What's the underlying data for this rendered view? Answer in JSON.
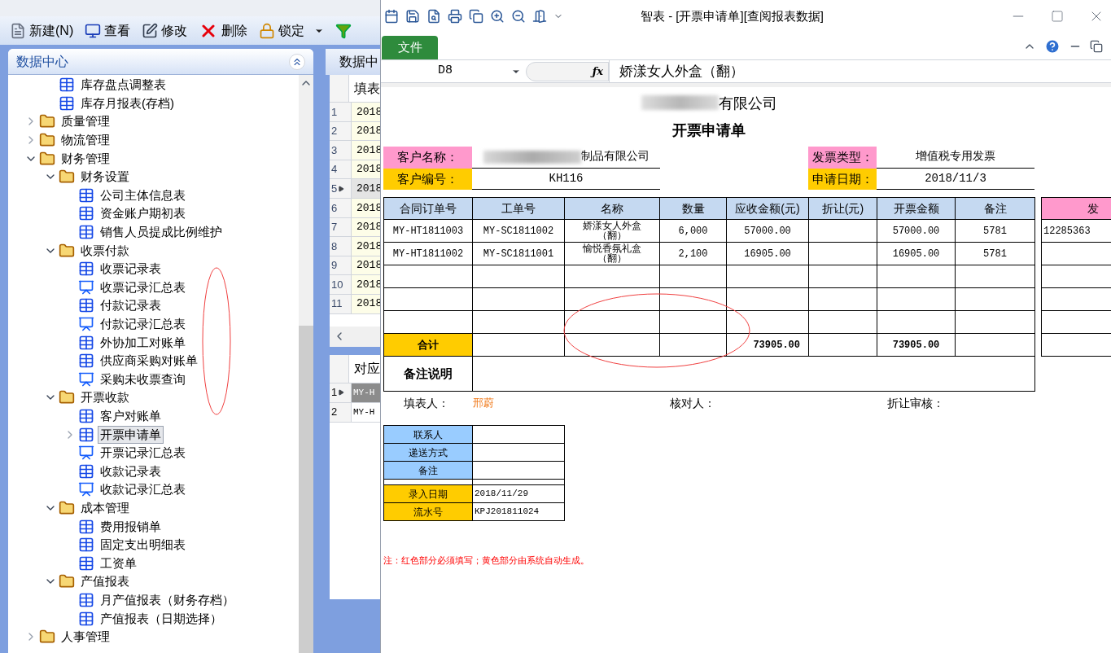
{
  "toolbar": [
    {
      "kind": "new",
      "label": "新建(N)"
    },
    {
      "kind": "view",
      "label": "查看"
    },
    {
      "kind": "edit",
      "label": "修改"
    },
    {
      "kind": "delete",
      "label": "删除"
    },
    {
      "kind": "lock",
      "label": "锁定"
    },
    {
      "kind": "filter"
    }
  ],
  "sidebar": {
    "title": "数据中心",
    "partial_items": [
      {
        "kind": "table",
        "label": "库存盘点调整表",
        "selected": false
      },
      {
        "kind": "table",
        "label": "库存月报表(存档)",
        "selected": false
      }
    ],
    "tree": [
      {
        "kind": "folder",
        "label": "质量管理",
        "expanded": false,
        "selected": false
      },
      {
        "kind": "folder",
        "label": "物流管理",
        "expanded": false,
        "selected": false
      },
      {
        "kind": "folder",
        "label": "财务管理",
        "expanded": true,
        "selected": false,
        "children": [
          {
            "kind": "folder",
            "label": "财务设置",
            "expanded": true,
            "selected": false,
            "children": [
              {
                "kind": "table",
                "label": "公司主体信息表",
                "selected": false
              },
              {
                "kind": "table",
                "label": "资金账户期初表",
                "selected": false
              },
              {
                "kind": "table",
                "label": "销售人员提成比例维护",
                "selected": false
              }
            ]
          },
          {
            "kind": "folder",
            "label": "收票付款",
            "expanded": true,
            "selected": false,
            "children": [
              {
                "kind": "table",
                "label": "收票记录表",
                "selected": false
              },
              {
                "kind": "summary",
                "label": "收票记录汇总表",
                "selected": false
              },
              {
                "kind": "table",
                "label": "付款记录表",
                "selected": false
              },
              {
                "kind": "summary",
                "label": "付款记录汇总表",
                "selected": false
              },
              {
                "kind": "table",
                "label": "外协加工对账单",
                "selected": false
              },
              {
                "kind": "table",
                "label": "供应商采购对账单",
                "selected": false
              },
              {
                "kind": "summary",
                "label": "采购未收票查询",
                "selected": false
              }
            ]
          },
          {
            "kind": "folder",
            "label": "开票收款",
            "expanded": true,
            "selected": false,
            "children": [
              {
                "kind": "table",
                "label": "客户对账单",
                "selected": false
              },
              {
                "kind": "table",
                "label": "开票申请单",
                "selected": true,
                "expanded": false
              },
              {
                "kind": "summary",
                "label": "开票记录汇总表",
                "selected": false
              },
              {
                "kind": "table",
                "label": "收款记录表",
                "selected": false
              },
              {
                "kind": "summary",
                "label": "收款记录汇总表",
                "selected": false
              }
            ]
          },
          {
            "kind": "folder",
            "label": "成本管理",
            "expanded": true,
            "selected": false,
            "children": [
              {
                "kind": "table",
                "label": "费用报销单",
                "selected": false
              },
              {
                "kind": "table",
                "label": "固定支出明细表",
                "selected": false
              },
              {
                "kind": "table",
                "label": "工资单",
                "selected": false
              }
            ]
          },
          {
            "kind": "folder",
            "label": "产值报表",
            "expanded": true,
            "selected": false,
            "children": [
              {
                "kind": "table",
                "label": "月产值报表（财务存档）",
                "selected": false
              },
              {
                "kind": "table",
                "label": "产值报表（日期选择）",
                "selected": false
              }
            ]
          }
        ]
      },
      {
        "kind": "folder",
        "label": "人事管理",
        "expanded": false,
        "selected": false
      }
    ]
  },
  "middle": {
    "tab": "数据中",
    "header": "填表",
    "rows": [
      {
        "num": "1",
        "cell": "2018",
        "selected": false
      },
      {
        "num": "2",
        "cell": "2018",
        "selected": false
      },
      {
        "num": "3",
        "cell": "2018",
        "selected": false
      },
      {
        "num": "4",
        "cell": "2018",
        "selected": false
      },
      {
        "num": "5",
        "cell": "2018",
        "selected": true
      },
      {
        "num": "6",
        "cell": "2018",
        "selected": false
      },
      {
        "num": "7",
        "cell": "2018",
        "selected": false
      },
      {
        "num": "8",
        "cell": "2018",
        "selected": false
      },
      {
        "num": "9",
        "cell": "2018",
        "selected": false
      },
      {
        "num": "10",
        "cell": "2018",
        "selected": false
      },
      {
        "num": "11",
        "cell": "2018",
        "selected": false
      }
    ],
    "lower_header": "对应",
    "lower_rows": [
      {
        "num": "1",
        "cell": "MY-H",
        "selected": true
      },
      {
        "num": "2",
        "cell": "MY-H",
        "selected": false
      }
    ]
  },
  "window": {
    "title": "智表 - [开票申请单][查阅报表数据]",
    "file_tab": "文件",
    "cell_ref": "D8",
    "function_label": "ƒx",
    "formula": "娇漾女人外盒（翻）"
  },
  "sheet": {
    "company": "有限公司",
    "form_title": "开票申请单",
    "left_fields": [
      {
        "label": "客户名称：",
        "value": "制品有限公司",
        "kind": "required",
        "redacted": true
      },
      {
        "label": "客户编号：",
        "value": "KH116",
        "kind": "auto",
        "redacted": false
      }
    ],
    "right_fields": [
      {
        "label": "发票类型：",
        "value": "增值税专用发票",
        "kind": "required",
        "redacted": false
      },
      {
        "label": "申请日期：",
        "value": "2018/11/3",
        "kind": "auto",
        "redacted": false
      }
    ],
    "columns": [
      "合同订单号",
      "工单号",
      "名称",
      "数量",
      "应收金额(元)",
      "折让(元)",
      "开票金额",
      "备注"
    ],
    "rows": [
      {
        "cells": [
          "MY-HT1811003",
          "MY-SC1811002",
          "娇漾女人外盒（翻）",
          "6,000",
          "57000.00",
          null,
          "57000.00",
          "5781"
        ]
      },
      {
        "cells": [
          "MY-HT1811002",
          "MY-SC1811001",
          "愉悦香氛礼盒（翻）",
          "2,100",
          "16905.00",
          null,
          "16905.00",
          "5781"
        ]
      }
    ],
    "total": {
      "label": "合计",
      "receivable": "73905.00",
      "invoiced": "73905.00"
    },
    "remarks_label": "备注说明",
    "side_column": {
      "header": "发",
      "values": [
        "12285363"
      ]
    },
    "signatures": [
      {
        "label": "填表人：",
        "value": "邢蔚"
      },
      {
        "label": "核对人："
      },
      {
        "label": "折让审核："
      }
    ],
    "contact_rows": [
      {
        "label": "联系人",
        "kind": "input"
      },
      {
        "label": "递送方式",
        "kind": "input"
      },
      {
        "label": "备注",
        "kind": "input"
      },
      {
        "label": "录入日期",
        "value": "2018/11/29",
        "kind": "auto"
      },
      {
        "label": "流水号",
        "value": "KPJ201811024",
        "kind": "auto"
      }
    ],
    "note": "注：红色部分必须填写；黄色部分由系统自动生成。"
  }
}
